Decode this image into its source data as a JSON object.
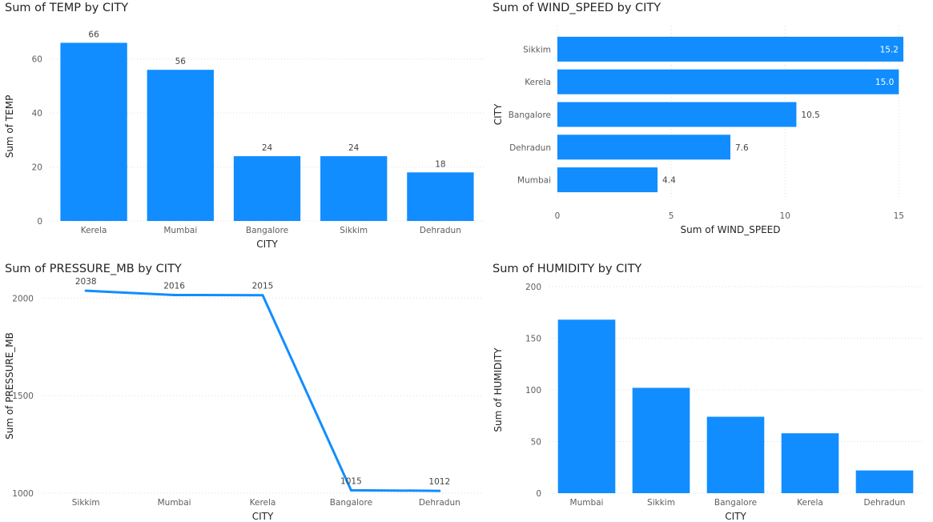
{
  "colors": {
    "bar": "#118dff",
    "grid": "#dcdcdc",
    "text": "#252423",
    "tick": "#605e5c"
  },
  "chart_data": [
    {
      "id": "temp",
      "type": "bar",
      "orientation": "vertical",
      "title": "Sum of TEMP by CITY",
      "xlabel": "CITY",
      "ylabel": "Sum of TEMP",
      "categories": [
        "Kerela",
        "Mumbai",
        "Bangalore",
        "Sikkim",
        "Dehradun"
      ],
      "values": [
        66,
        56,
        24,
        24,
        18
      ],
      "value_labels": [
        "66",
        "56",
        "24",
        "24",
        "18"
      ],
      "ylim": [
        0,
        70
      ],
      "yticks": [
        0,
        20,
        40,
        60
      ],
      "ytick_labels": [
        "0",
        "20",
        "40",
        "60"
      ],
      "grid": true
    },
    {
      "id": "wind",
      "type": "bar",
      "orientation": "horizontal",
      "title": "Sum of WIND_SPEED by CITY",
      "xlabel": "Sum of WIND_SPEED",
      "ylabel": "CITY",
      "categories": [
        "Sikkim",
        "Kerela",
        "Bangalore",
        "Dehradun",
        "Mumbai"
      ],
      "values": [
        15.2,
        15.0,
        10.5,
        7.6,
        4.4
      ],
      "value_labels": [
        "15.2",
        "15.0",
        "10.5",
        "7.6",
        "4.4"
      ],
      "xlim": [
        0,
        15.2
      ],
      "xticks": [
        0,
        5,
        10,
        15
      ],
      "xtick_labels": [
        "0",
        "5",
        "10",
        "15"
      ],
      "grid": true
    },
    {
      "id": "pressure",
      "type": "line",
      "title": "Sum of PRESSURE_MB by CITY",
      "xlabel": "CITY",
      "ylabel": "Sum of PRESSURE_MB",
      "categories": [
        "Sikkim",
        "Mumbai",
        "Kerela",
        "Bangalore",
        "Dehradun"
      ],
      "values": [
        2038,
        2016,
        2015,
        1015,
        1012
      ],
      "value_labels": [
        "2038",
        "2016",
        "2015",
        "1015",
        "1012"
      ],
      "ylim": [
        1000,
        2100
      ],
      "yticks": [
        1000,
        1500,
        2000
      ],
      "ytick_labels": [
        "1000",
        "1500",
        "2000"
      ],
      "grid": true
    },
    {
      "id": "humidity",
      "type": "bar",
      "orientation": "vertical",
      "title": "Sum of HUMIDITY by CITY",
      "xlabel": "CITY",
      "ylabel": "Sum of HUMIDITY",
      "categories": [
        "Mumbai",
        "Sikkim",
        "Bangalore",
        "Kerela",
        "Dehradun"
      ],
      "values": [
        168,
        102,
        74,
        58,
        22
      ],
      "value_labels": [],
      "ylim": [
        0,
        200
      ],
      "yticks": [
        0,
        50,
        100,
        150,
        200
      ],
      "ytick_labels": [
        "0",
        "50",
        "100",
        "150",
        "200"
      ],
      "grid": true
    }
  ]
}
